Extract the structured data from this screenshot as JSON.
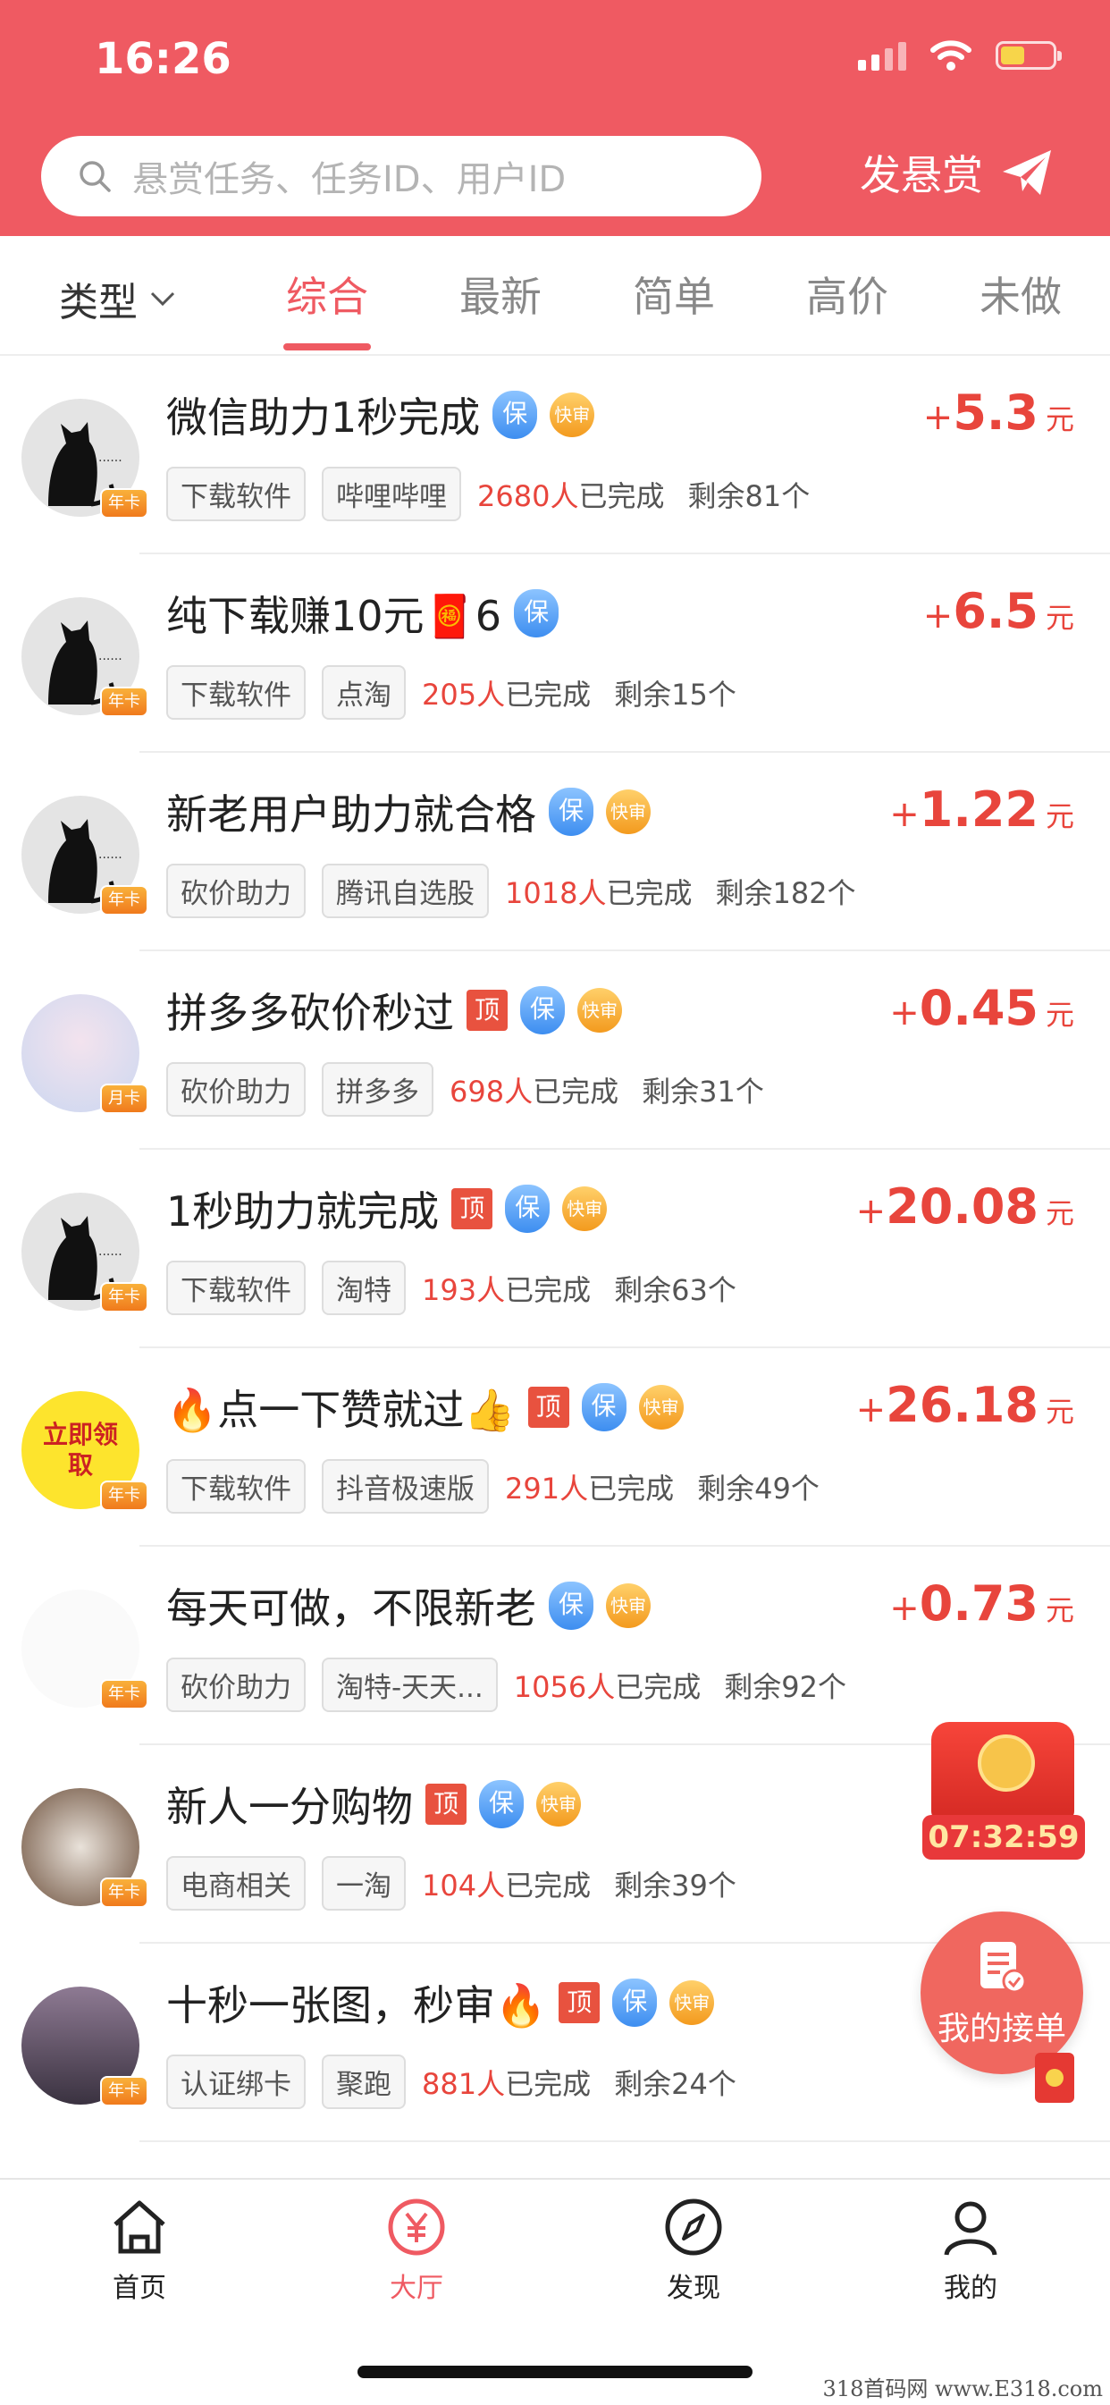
{
  "status_bar": {
    "time": "16:26"
  },
  "search": {
    "placeholder": "悬赏任务、任务ID、用户ID"
  },
  "post_bounty": {
    "label": "发悬赏"
  },
  "filter": {
    "type_label": "类型"
  },
  "tabs": [
    {
      "label": "综合",
      "active": true
    },
    {
      "label": "最新",
      "active": false
    },
    {
      "label": "简单",
      "active": false
    },
    {
      "label": "高价",
      "active": false
    },
    {
      "label": "未做",
      "active": false
    }
  ],
  "badges": {
    "top": "顶",
    "bao": "保",
    "fast": "快审",
    "vip": "年卡",
    "vip_month": "月卡"
  },
  "tasks": [
    {
      "title": "微信助力1秒完成",
      "badges": [
        "bao",
        "fast"
      ],
      "tags": [
        "下载软件",
        "哔哩哔哩"
      ],
      "done_count": "2680人",
      "done_text": "已完成",
      "remain": "剩余81个",
      "reward_plus": "+",
      "reward": "5.3",
      "unit": "元",
      "vip": "年卡"
    },
    {
      "title": "纯下载赚10元🧧6",
      "badges": [
        "bao"
      ],
      "tags": [
        "下载软件",
        "点淘"
      ],
      "done_count": "205人",
      "done_text": "已完成",
      "remain": "剩余15个",
      "reward_plus": "+",
      "reward": "6.5",
      "unit": "元",
      "vip": "年卡"
    },
    {
      "title": "新老用户助力就合格",
      "badges": [
        "bao",
        "fast"
      ],
      "tags": [
        "砍价助力",
        "腾讯自选股"
      ],
      "done_count": "1018人",
      "done_text": "已完成",
      "remain": "剩余182个",
      "reward_plus": "+",
      "reward": "1.22",
      "unit": "元",
      "vip": "年卡"
    },
    {
      "title": "拼多多砍价秒过",
      "badges": [
        "top",
        "bao",
        "fast"
      ],
      "tags": [
        "砍价助力",
        "拼多多"
      ],
      "done_count": "698人",
      "done_text": "已完成",
      "remain": "剩余31个",
      "reward_plus": "+",
      "reward": "0.45",
      "unit": "元",
      "vip": "月卡"
    },
    {
      "title": "1秒助力就完成",
      "badges": [
        "top",
        "bao",
        "fast"
      ],
      "tags": [
        "下载软件",
        "淘特"
      ],
      "done_count": "193人",
      "done_text": "已完成",
      "remain": "剩余63个",
      "reward_plus": "+",
      "reward": "20.08",
      "unit": "元",
      "vip": "年卡"
    },
    {
      "title": "🔥点一下赞就过👍",
      "badges": [
        "top",
        "bao",
        "fast"
      ],
      "tags": [
        "下载软件",
        "抖音极速版"
      ],
      "done_count": "291人",
      "done_text": "已完成",
      "remain": "剩余49个",
      "reward_plus": "+",
      "reward": "26.18",
      "unit": "元",
      "vip": "年卡",
      "avatar_text": "立即领取"
    },
    {
      "title": "每天可做，不限新老",
      "badges": [
        "bao",
        "fast"
      ],
      "tags": [
        "砍价助力",
        "淘特-天天..."
      ],
      "done_count": "1056人",
      "done_text": "已完成",
      "remain": "剩余92个",
      "reward_plus": "+",
      "reward": "0.73",
      "unit": "元",
      "vip": "年卡"
    },
    {
      "title": "新人一分购物",
      "badges": [
        "top",
        "bao",
        "fast"
      ],
      "tags": [
        "电商相关",
        "一淘"
      ],
      "done_count": "104人",
      "done_text": "已完成",
      "remain": "剩余39个",
      "reward_plus": "",
      "reward": "",
      "unit": "",
      "vip": "年卡"
    },
    {
      "title": "十秒一张图，秒审🔥",
      "badges": [
        "top",
        "bao",
        "fast"
      ],
      "tags": [
        "认证绑卡",
        "聚跑"
      ],
      "done_count": "881人",
      "done_text": "已完成",
      "remain": "剩余24个",
      "reward_plus": "",
      "reward": "",
      "unit": "",
      "vip": "年卡"
    }
  ],
  "float_timer": {
    "countdown": "07:32:59"
  },
  "float_orders": {
    "label": "我的接单"
  },
  "bottom_nav": [
    {
      "label": "首页",
      "icon": "home-icon",
      "active": false
    },
    {
      "label": "大厅",
      "icon": "yuan-icon",
      "active": true
    },
    {
      "label": "发现",
      "icon": "compass-icon",
      "active": false
    },
    {
      "label": "我的",
      "icon": "user-icon",
      "active": false
    }
  ],
  "watermark": "318首码网 www.E318.com",
  "colors": {
    "primary": "#ef5a62",
    "reward": "#e8453c"
  }
}
